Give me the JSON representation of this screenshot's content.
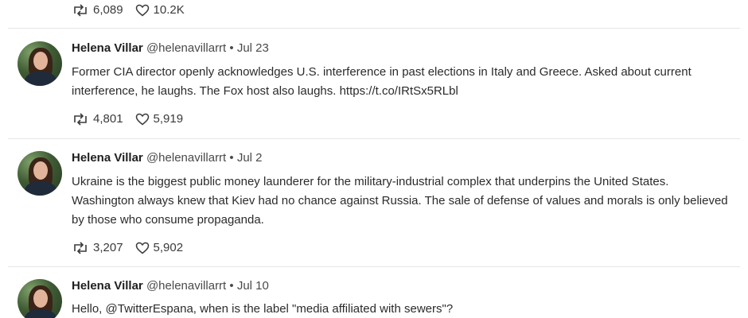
{
  "top_stats": {
    "retweets": "6,089",
    "likes": "10.2K"
  },
  "tweets": [
    {
      "name": "Helena Villar",
      "handle": "@helenavillarrt",
      "separator": "•",
      "date": "Jul 23",
      "text": "Former CIA director openly acknowledges U.S. interference in past elections in Italy and Greece. Asked about current interference, he laughs. The Fox host also laughs. https://t.co/IRtSx5RLbl",
      "retweets": "4,801",
      "likes": "5,919"
    },
    {
      "name": "Helena Villar",
      "handle": "@helenavillarrt",
      "separator": "•",
      "date": "Jul 2",
      "text": "Ukraine is the biggest public money launderer for the military-industrial complex that underpins the United States. Washington always knew that Kiev had no chance against Russia. The sale of defense of values and morals is only believed by those who consume propaganda.",
      "retweets": "3,207",
      "likes": "5,902"
    },
    {
      "name": "Helena Villar",
      "handle": "@helenavillarrt",
      "separator": "•",
      "date": "Jul 10",
      "text": "Hello, @TwitterEspana, when is the label \"media affiliated with sewers\"?"
    }
  ],
  "icons": {
    "retweet": "retweet-icon",
    "like": "heart-icon"
  }
}
